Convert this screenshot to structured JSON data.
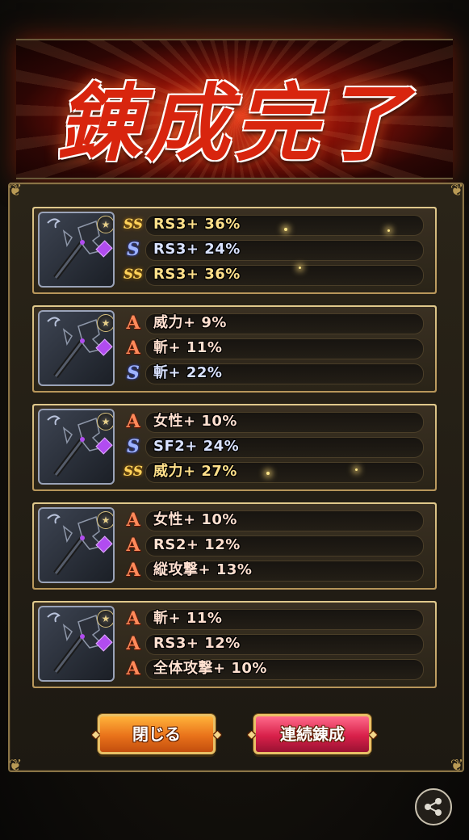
{
  "title": "錬成完了",
  "cards": [
    {
      "rows": [
        {
          "type": "ss",
          "text": "RS3+ 36%"
        },
        {
          "type": "s",
          "text": "RS3+ 24%"
        },
        {
          "type": "ss",
          "text": "RS3+ 36%"
        }
      ]
    },
    {
      "rows": [
        {
          "type": "a",
          "text": "威力+ 9%"
        },
        {
          "type": "a",
          "text": "斬+ 11%"
        },
        {
          "type": "s",
          "text": "斬+ 22%"
        }
      ]
    },
    {
      "rows": [
        {
          "type": "a",
          "text": "女性+ 10%"
        },
        {
          "type": "s",
          "text": "SF2+ 24%"
        },
        {
          "type": "ss",
          "text": "威力+ 27%"
        }
      ]
    },
    {
      "rows": [
        {
          "type": "a",
          "text": "女性+ 10%"
        },
        {
          "type": "a",
          "text": "RS2+ 12%"
        },
        {
          "type": "a",
          "text": "縦攻撃+ 13%"
        }
      ]
    },
    {
      "rows": [
        {
          "type": "a",
          "text": "斬+ 11%"
        },
        {
          "type": "a",
          "text": "RS3+ 12%"
        },
        {
          "type": "a",
          "text": "全体攻撃+ 10%"
        }
      ]
    }
  ],
  "icons": {
    "a": "A",
    "s": "S",
    "ss": "SS"
  },
  "buttons": {
    "close": "閉じる",
    "continue": "連続錬成"
  },
  "share_icon": "share-icon"
}
